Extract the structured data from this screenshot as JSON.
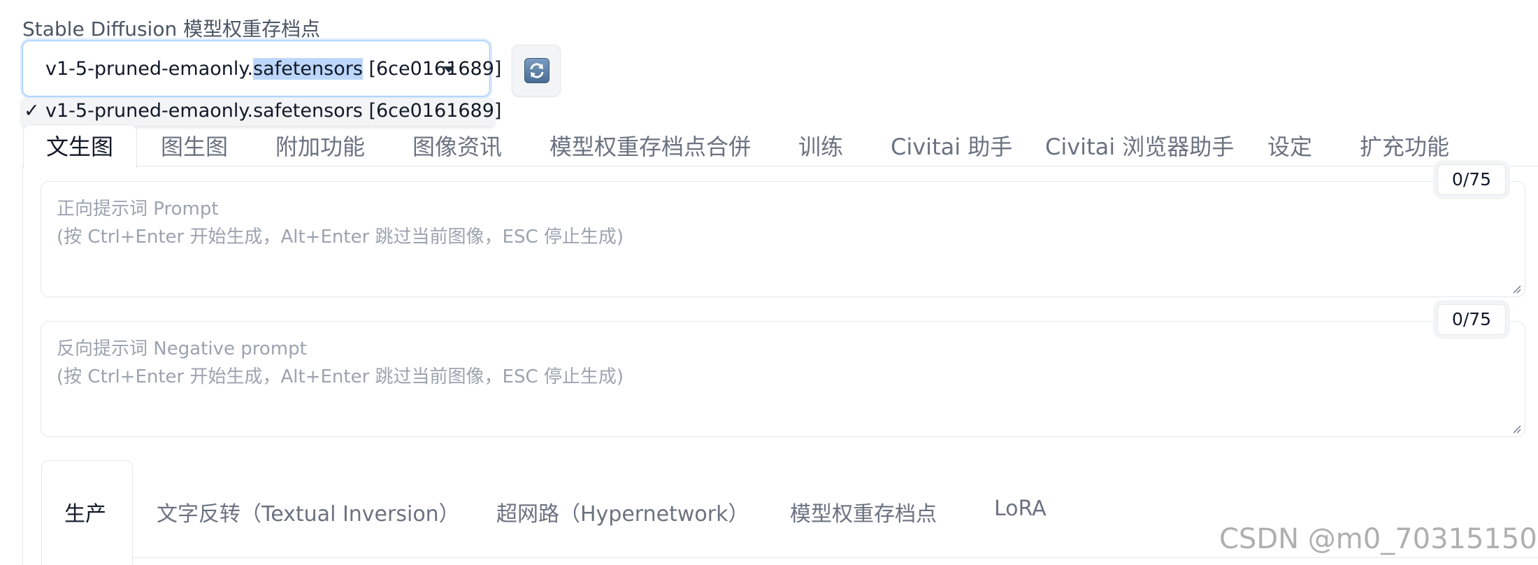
{
  "checkpoint": {
    "label": "Stable Diffusion 模型权重存档点",
    "value_prefix": "v1-5-pruned-emaonly.",
    "value_highlight": "safetensors",
    "value_suffix": " [6ce0161689]",
    "option_check": "✓",
    "option_text": "v1-5-pruned-emaonly.safetensors [6ce0161689]",
    "refresh_icon": "refresh-icon"
  },
  "tabs": [
    "文生图",
    "图生图",
    "附加功能",
    "图像资讯",
    "模型权重存档点合併",
    "训练",
    "Civitai 助手",
    "Civitai 浏览器助手",
    "设定",
    "扩充功能"
  ],
  "prompt": {
    "placeholder_1": "正向提示词 Prompt",
    "placeholder_2": "(按 Ctrl+Enter 开始生成，Alt+Enter 跳过当前图像，ESC 停止生成)",
    "counter": "0/75"
  },
  "negative_prompt": {
    "placeholder_1": "反向提示词 Negative prompt",
    "placeholder_2": "(按 Ctrl+Enter 开始生成，Alt+Enter 跳过当前图像，ESC 停止生成)",
    "counter": "0/75"
  },
  "subtabs": [
    "生产",
    "文字反转（Textual Inversion）",
    "超网路（Hypernetwork）",
    "模型权重存档点",
    "LoRA"
  ],
  "watermark": "CSDN @m0_70315150"
}
